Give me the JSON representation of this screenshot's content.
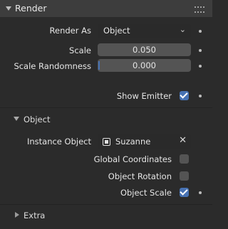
{
  "render_panel": {
    "title": "Render",
    "render_as": {
      "label": "Render As",
      "value": "Object"
    },
    "scale": {
      "label": "Scale",
      "value": "0.050"
    },
    "scale_randomness": {
      "label": "Scale Randomness",
      "value": "0.000"
    },
    "show_emitter": {
      "label": "Show Emitter",
      "checked": true
    }
  },
  "object_subpanel": {
    "title": "Object",
    "instance_object": {
      "label": "Instance Object",
      "value": "Suzanne"
    },
    "global_coordinates": {
      "label": "Global Coordinates",
      "checked": false
    },
    "object_rotation": {
      "label": "Object Rotation",
      "checked": false
    },
    "object_scale": {
      "label": "Object Scale",
      "checked": true
    }
  },
  "extra_subpanel": {
    "title": "Extra"
  },
  "colors": {
    "accent": "#4772b3",
    "panel_bg": "#2b2b2b",
    "field_bg": "#545454"
  }
}
